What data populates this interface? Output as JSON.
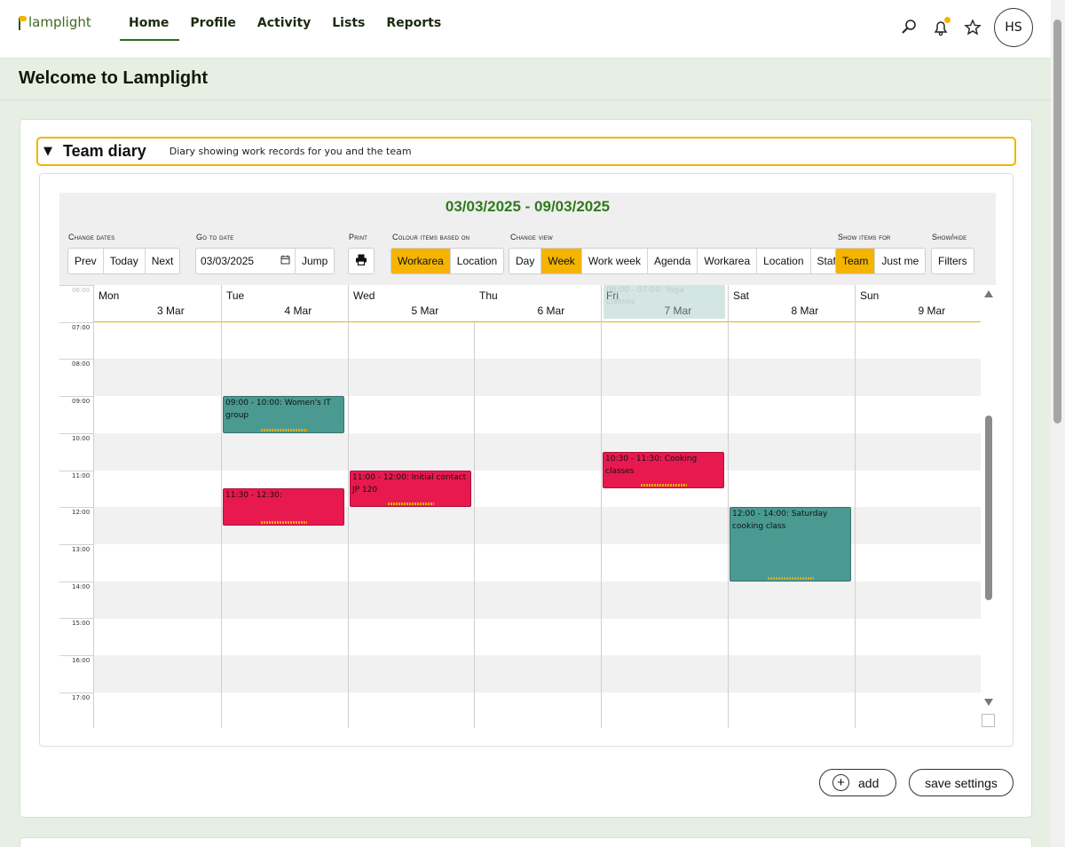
{
  "app": {
    "logo": "lamplight"
  },
  "nav": [
    {
      "label": "Home",
      "active": true
    },
    {
      "label": "Profile"
    },
    {
      "label": "Activity"
    },
    {
      "label": "Lists"
    },
    {
      "label": "Reports"
    }
  ],
  "user": {
    "initials": "HS"
  },
  "icons": {
    "search": "search-icon",
    "bell": "bell-icon",
    "star": "star-icon"
  },
  "page": {
    "title": "Welcome to Lamplight"
  },
  "diary": {
    "title": "Team diary",
    "subtitle": "Diary showing work records for you and the team",
    "range": "03/03/2025 - 09/03/2025",
    "controls": {
      "change_dates_label": "Change dates",
      "prev": "Prev",
      "today": "Today",
      "next": "Next",
      "goto_label": "Go to date",
      "goto_value": "03/03/2025",
      "jump": "Jump",
      "print_label": "Print",
      "colour_label": "Colour items based on",
      "colour_workarea": "Workarea",
      "colour_location": "Location",
      "view_label": "Change view",
      "view_day": "Day",
      "view_week": "Week",
      "view_workweek": "Work week",
      "view_agenda": "Agenda",
      "view_workarea": "Workarea",
      "view_location": "Location",
      "view_staff": "Staff",
      "show_items_label": "Show items for",
      "show_team": "Team",
      "show_justme": "Just me",
      "showhide_label": "Show/hide",
      "filters": "Filters"
    },
    "days": [
      {
        "name": "Mon",
        "date": "3 Mar"
      },
      {
        "name": "Tue",
        "date": "4 Mar"
      },
      {
        "name": "Wed",
        "date": "5 Mar"
      },
      {
        "name": "Thu",
        "date": "6 Mar"
      },
      {
        "name": "Fri",
        "date": "7 Mar"
      },
      {
        "name": "Sat",
        "date": "8 Mar"
      },
      {
        "name": "Sun",
        "date": "9 Mar"
      }
    ],
    "times": [
      "06:00",
      "07:00",
      "08:00",
      "09:00",
      "10:00",
      "11:00",
      "12:00",
      "13:00",
      "14:00",
      "15:00",
      "16:00",
      "17:00"
    ],
    "events": [
      {
        "text": "09:00 - 10:00: Women's IT group",
        "day": 1,
        "start": 9,
        "end": 10,
        "color": "#4a9a92"
      },
      {
        "text": "11:30 - 12:30:",
        "day": 1,
        "start": 11.5,
        "end": 12.5,
        "color": "#e7194f"
      },
      {
        "text": "11:00 - 12:00: Initial contact JP 120",
        "day": 2,
        "start": 11,
        "end": 12,
        "color": "#e7194f"
      },
      {
        "text": "10:30 - 11:30: Cooking classes",
        "day": 4,
        "start": 10.5,
        "end": 11.5,
        "color": "#e7194f"
      },
      {
        "text": "12:00 - 14:00: Saturday cooking class",
        "day": 5,
        "start": 12,
        "end": 14,
        "color": "#4a9a92"
      }
    ],
    "ghost_event": "06:00 - 07:00: Yoga classes"
  },
  "actions": {
    "add": "add",
    "save": "save settings"
  }
}
